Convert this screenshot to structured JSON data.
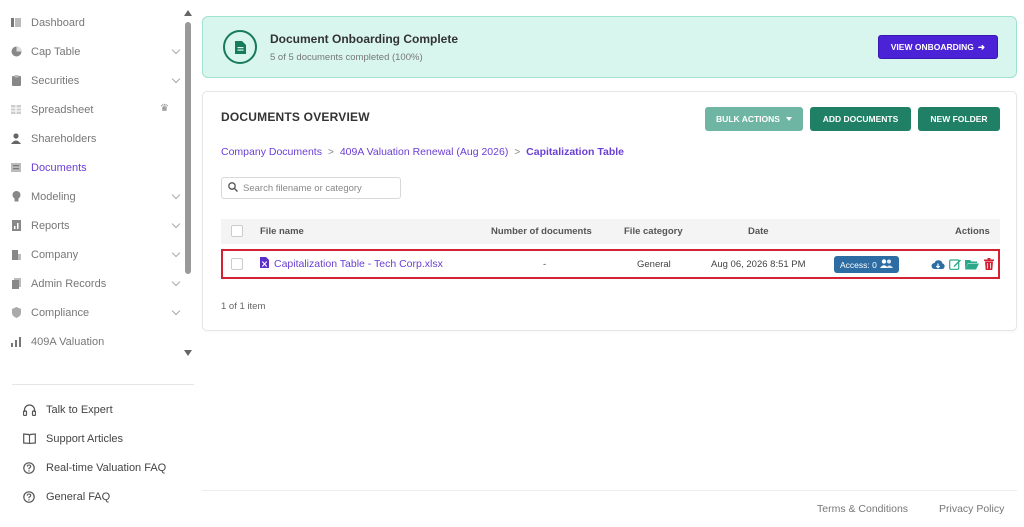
{
  "sidebar": {
    "items": [
      {
        "label": "Dashboard"
      },
      {
        "label": "Cap Table"
      },
      {
        "label": "Securities"
      },
      {
        "label": "Spreadsheet"
      },
      {
        "label": "Shareholders"
      },
      {
        "label": "Documents"
      },
      {
        "label": "Modeling"
      },
      {
        "label": "Reports"
      },
      {
        "label": "Company"
      },
      {
        "label": "Admin Records"
      },
      {
        "label": "Compliance"
      },
      {
        "label": "409A Valuation"
      }
    ],
    "help": [
      {
        "label": "Talk to Expert"
      },
      {
        "label": "Support Articles"
      },
      {
        "label": "Real-time Valuation FAQ"
      },
      {
        "label": "General FAQ"
      }
    ]
  },
  "banner": {
    "title": "Document Onboarding Complete",
    "subtitle": "5 of 5 documents completed (100%)",
    "button": "VIEW ONBOARDING"
  },
  "documents": {
    "title": "DOCUMENTS OVERVIEW",
    "bulk_actions": "BULK ACTIONS",
    "add_documents": "ADD DOCUMENTS",
    "new_folder": "NEW FOLDER",
    "breadcrumb": [
      "Company Documents",
      "409A Valuation Renewal (Aug 2026)",
      "Capitalization Table"
    ],
    "search_placeholder": "Search filename or category",
    "columns": {
      "file_name": "File name",
      "number_of_documents": "Number of documents",
      "file_category": "File category",
      "date": "Date",
      "actions": "Actions"
    },
    "rows": [
      {
        "file_name": "Capitalization Table - Tech Corp.xlsx",
        "number_of_documents": "-",
        "file_category": "General",
        "date": "Aug 06, 2026 8:51 PM",
        "access": "Access: 0"
      }
    ],
    "count": "1 of 1 item"
  },
  "footer": {
    "terms": "Terms & Conditions",
    "privacy": "Privacy Policy"
  },
  "colors": {
    "accent": "#6b3fd4",
    "primary_button": "#4c22d6",
    "green_button": "#1f8066",
    "banner_bg": "#d8f6ee",
    "highlight": "#d32233"
  }
}
